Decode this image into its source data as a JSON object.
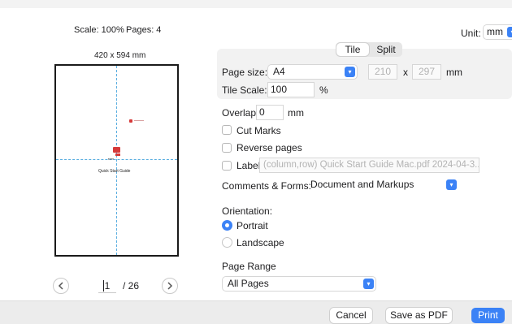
{
  "preview": {
    "scale_label": "Scale: 100%",
    "pages_label": "Pages: 4",
    "size_label": "420 x 594 mm",
    "page_title_text": "Quick Start Guide",
    "current_page": "1",
    "total_pages": "/ 26",
    "prev_icon": "chevron-left-icon",
    "next_icon": "chevron-right-icon"
  },
  "unit": {
    "label": "Unit:",
    "value": "mm"
  },
  "tabs": [
    {
      "label": "Tile",
      "active": true
    },
    {
      "label": "Split",
      "active": false
    }
  ],
  "page_size": {
    "label": "Page size:",
    "value": "A4",
    "width": "210",
    "times": "x",
    "height": "297",
    "unit": "mm"
  },
  "tile_scale": {
    "label": "Tile Scale:",
    "value": "100",
    "unit": "%"
  },
  "overlap": {
    "label": "Overlap:",
    "value": "0",
    "unit": "mm"
  },
  "cut_marks": {
    "label": "Cut Marks",
    "checked": false
  },
  "reverse_pages": {
    "label": "Reverse pages",
    "checked": false
  },
  "label_option": {
    "label": "Label",
    "checked": false,
    "value": "(column,row) Quick Start Guide Mac.pdf 2024-04-3..."
  },
  "comments_forms": {
    "label": "Comments & Forms:",
    "value": "Document and Markups"
  },
  "orientation": {
    "label": "Orientation:",
    "options": [
      {
        "label": "Portrait",
        "selected": true
      },
      {
        "label": "Landscape",
        "selected": false
      }
    ]
  },
  "page_range": {
    "label": "Page Range",
    "value": "All Pages"
  },
  "footer": {
    "cancel": "Cancel",
    "save_pdf": "Save as PDF",
    "print": "Print"
  },
  "colors": {
    "accent": "#3b82f6",
    "guide": "#5aaee0",
    "mark": "#d63a3a"
  }
}
